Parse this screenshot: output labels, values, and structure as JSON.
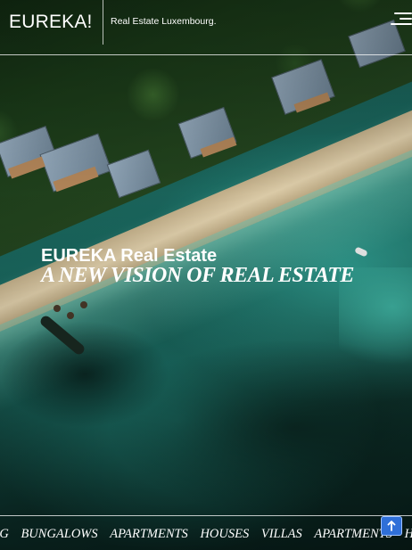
{
  "header": {
    "logo": "EUREKA!",
    "tagline": "Real Estate Luxembourg."
  },
  "hero": {
    "title": "EUREKA Real Estate",
    "subtitle": "A NEW VISION OF REAL ESTATE"
  },
  "ticker": {
    "items": [
      "URG",
      "BUNGALOWS",
      "APARTMENTS",
      "HOUSES",
      "VILLAS",
      "APARTMENTS",
      "HO"
    ]
  },
  "icons": {
    "menu": "hamburger-menu-icon",
    "scroll_top": "arrow-up-icon"
  },
  "colors": {
    "scroll_top_button": "#2f6fd8",
    "text": "#ffffff"
  }
}
